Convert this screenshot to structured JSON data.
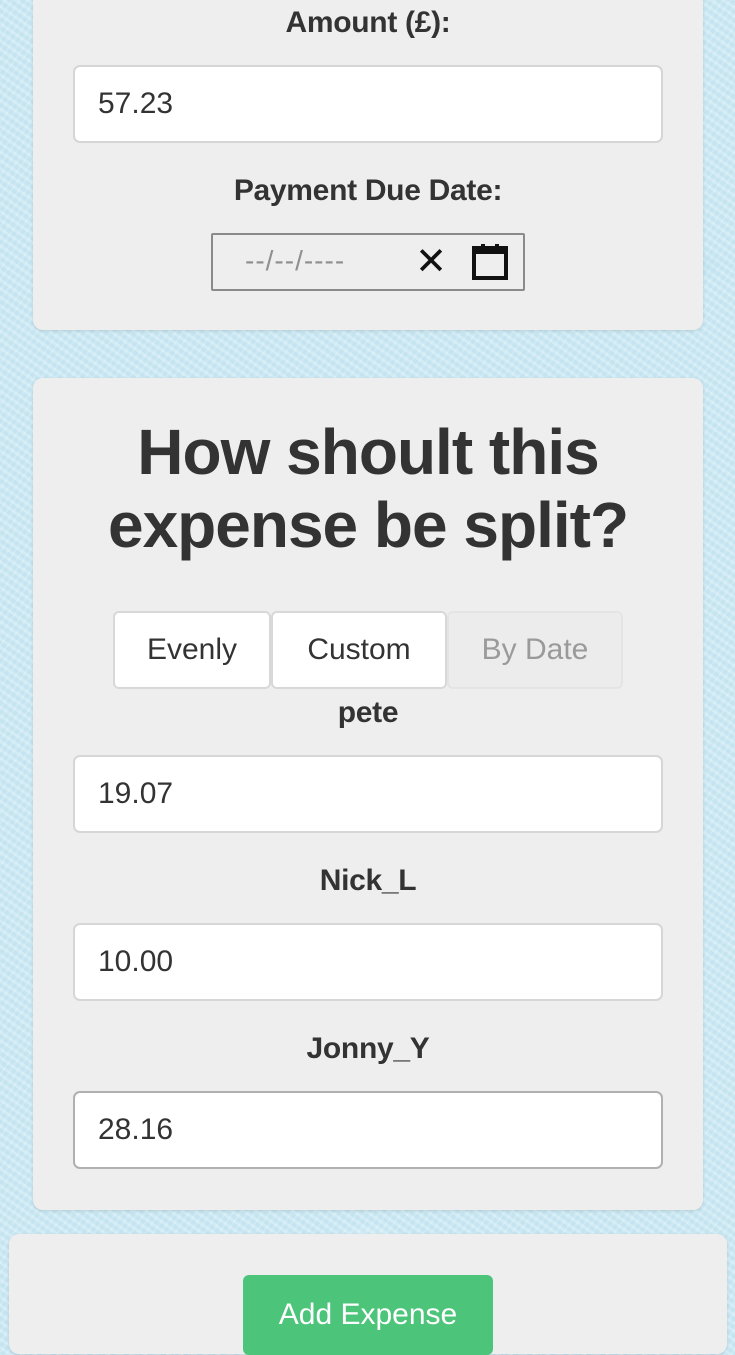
{
  "expense_form": {
    "amount_label": "Amount (£):",
    "amount_value": "57.23",
    "due_date_label": "Payment Due Date:",
    "due_date_placeholder": "--/--/----"
  },
  "split_section": {
    "heading_line1": "How shoult this",
    "heading_line2": "expense be split?",
    "options": [
      {
        "label": "Evenly",
        "state": "enabled"
      },
      {
        "label": "Custom",
        "state": "enabled"
      },
      {
        "label": "By Date",
        "state": "disabled"
      }
    ],
    "members": [
      {
        "name": "pete",
        "amount": "19.07"
      },
      {
        "name": "Nick_L",
        "amount": "10.00"
      },
      {
        "name": "Jonny_Y",
        "amount": "28.16"
      }
    ]
  },
  "actions": {
    "add_expense_label": "Add Expense"
  },
  "colors": {
    "background": "#cde9f4",
    "card": "#eeeeee",
    "primary_button": "#4cc47a",
    "text": "#333333"
  },
  "icons": {
    "clear": "close-icon",
    "calendar": "calendar-icon"
  }
}
